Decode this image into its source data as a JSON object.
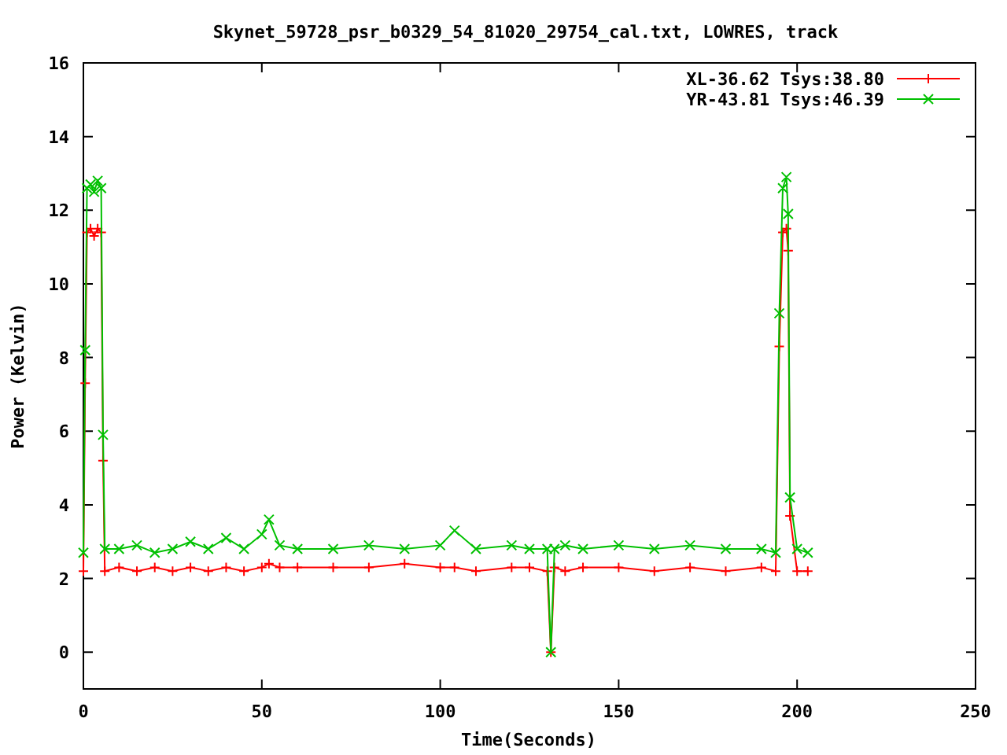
{
  "chart_data": {
    "type": "line",
    "title": "Skynet_59728_psr_b0329_54_81020_29754_cal.txt, LOWRES, track",
    "xlabel": "Time(Seconds)",
    "ylabel": "Power (Kelvin)",
    "x": [
      0,
      0.5,
      1,
      2,
      3,
      4,
      5,
      5.5,
      6,
      10,
      15,
      20,
      25,
      30,
      35,
      40,
      45,
      50,
      52,
      55,
      60,
      70,
      80,
      90,
      100,
      104,
      110,
      120,
      125,
      130,
      131,
      132,
      135,
      140,
      150,
      160,
      170,
      180,
      190,
      194,
      195,
      196,
      197,
      197.5,
      198,
      200,
      203
    ],
    "series": [
      {
        "name": "XL-36.62 Tsys:38.80",
        "color": "#ff0000",
        "marker": "plus",
        "values": [
          2.2,
          7.3,
          11.4,
          11.5,
          11.3,
          11.5,
          11.4,
          5.2,
          2.2,
          2.3,
          2.2,
          2.3,
          2.2,
          2.3,
          2.2,
          2.3,
          2.2,
          2.3,
          2.4,
          2.3,
          2.3,
          2.3,
          2.3,
          2.4,
          2.3,
          2.3,
          2.2,
          2.3,
          2.3,
          2.2,
          0,
          2.3,
          2.2,
          2.3,
          2.3,
          2.2,
          2.3,
          2.2,
          2.3,
          2.2,
          8.3,
          11.4,
          11.5,
          10.9,
          3.7,
          2.2,
          2.2
        ]
      },
      {
        "name": "YR-43.81 Tsys:46.39",
        "color": "#00c000",
        "marker": "cross",
        "values": [
          2.7,
          8.2,
          12.6,
          12.7,
          12.5,
          12.8,
          12.6,
          5.9,
          2.8,
          2.8,
          2.9,
          2.7,
          2.8,
          3.0,
          2.8,
          3.1,
          2.8,
          3.2,
          3.6,
          2.9,
          2.8,
          2.8,
          2.9,
          2.8,
          2.9,
          3.3,
          2.8,
          2.9,
          2.8,
          2.8,
          0,
          2.8,
          2.9,
          2.8,
          2.9,
          2.8,
          2.9,
          2.8,
          2.8,
          2.7,
          9.2,
          12.6,
          12.9,
          11.9,
          4.2,
          2.8,
          2.7
        ]
      }
    ],
    "legend": true,
    "xlim": [
      0,
      250
    ],
    "ylim": [
      -1,
      16
    ],
    "xticks": [
      0,
      50,
      100,
      150,
      200,
      250
    ],
    "yticks": [
      0,
      2,
      4,
      6,
      8,
      10,
      12,
      14,
      16
    ]
  }
}
